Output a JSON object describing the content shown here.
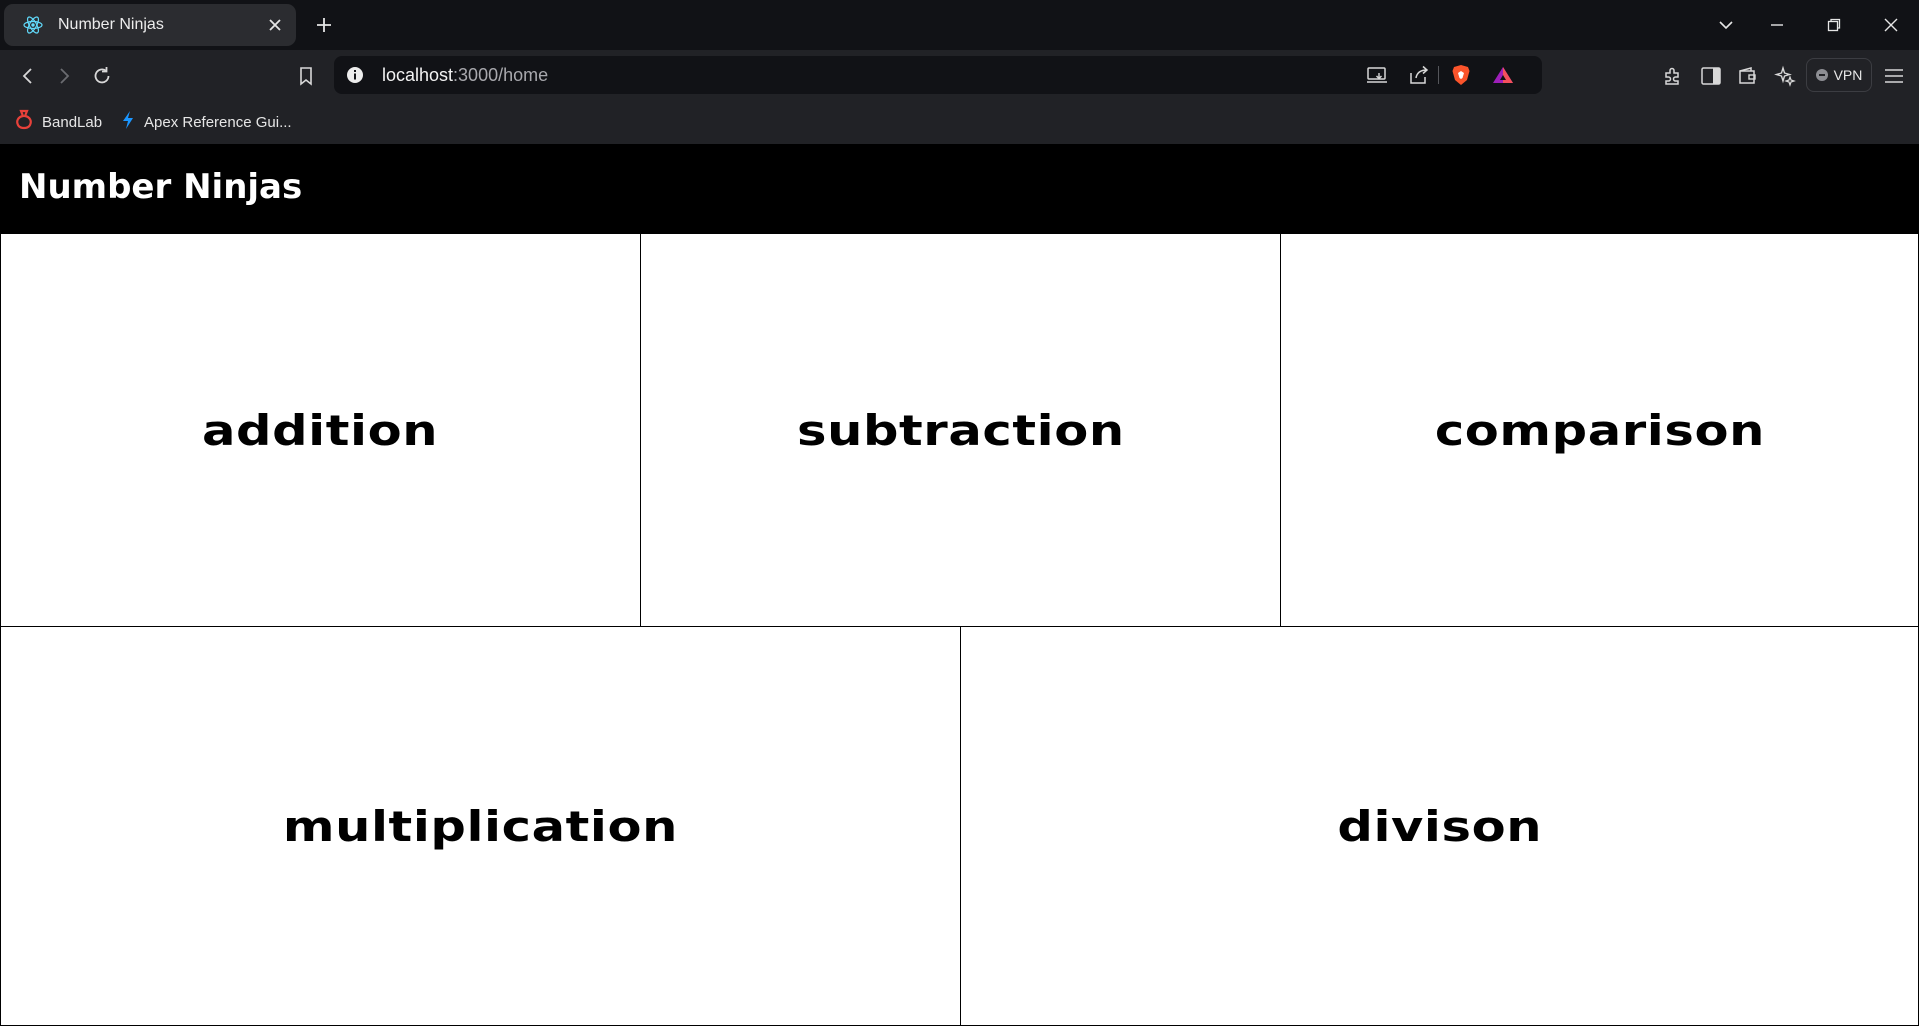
{
  "browser": {
    "tab": {
      "title": "Number Ninjas",
      "favicon": "react-icon"
    },
    "address": {
      "host": "localhost",
      "rest": ":3000/home"
    },
    "vpn_label": "VPN",
    "bookmarks": [
      {
        "label": "BandLab",
        "icon": "bandlab-icon"
      },
      {
        "label": "Apex Reference Gui...",
        "icon": "lightning-icon"
      }
    ],
    "colors": {
      "tabbar": "#111216",
      "toolbar": "#212226",
      "brave_orange": "#fb542b"
    }
  },
  "app": {
    "title": "Number Ninjas",
    "cards": [
      {
        "label": "addition"
      },
      {
        "label": "subtraction"
      },
      {
        "label": "comparison"
      },
      {
        "label": "multiplication"
      },
      {
        "label": "divison"
      }
    ]
  }
}
